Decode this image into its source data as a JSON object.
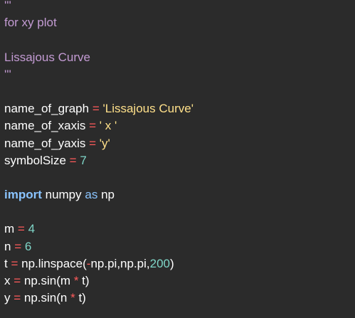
{
  "colors": {
    "background": "#2b2b2b",
    "docstring": "#c39bd3",
    "operator": "#ff5b5b",
    "string": "#ffe08a",
    "number": "#7fd6c8",
    "keyword": "#8ac4ff",
    "text": "#ffffff"
  },
  "lines": [
    [
      {
        "t": "doc",
        "v": "'''"
      }
    ],
    [
      {
        "t": "doc",
        "v": "for xy plot"
      }
    ],
    [],
    [
      {
        "t": "doc",
        "v": "Lissajous Curve"
      }
    ],
    [
      {
        "t": "doc",
        "v": "'''"
      }
    ],
    [],
    [
      {
        "t": "plain",
        "v": "name_of_graph "
      },
      {
        "t": "op",
        "v": "="
      },
      {
        "t": "plain",
        "v": " "
      },
      {
        "t": "str",
        "v": "'Lissajous Curve'"
      }
    ],
    [
      {
        "t": "plain",
        "v": "name_of_xaxis "
      },
      {
        "t": "op",
        "v": "="
      },
      {
        "t": "plain",
        "v": " "
      },
      {
        "t": "str",
        "v": "' x '"
      }
    ],
    [
      {
        "t": "plain",
        "v": "name_of_yaxis "
      },
      {
        "t": "op",
        "v": "="
      },
      {
        "t": "plain",
        "v": " "
      },
      {
        "t": "str",
        "v": "'y'"
      }
    ],
    [
      {
        "t": "plain",
        "v": "symbolSize "
      },
      {
        "t": "op",
        "v": "="
      },
      {
        "t": "plain",
        "v": " "
      },
      {
        "t": "num",
        "v": "7"
      }
    ],
    [],
    [
      {
        "t": "kw",
        "v": "import"
      },
      {
        "t": "plain",
        "v": " numpy "
      },
      {
        "t": "kw2",
        "v": "as"
      },
      {
        "t": "plain",
        "v": " np"
      }
    ],
    [],
    [
      {
        "t": "plain",
        "v": "m "
      },
      {
        "t": "op",
        "v": "="
      },
      {
        "t": "plain",
        "v": " "
      },
      {
        "t": "num",
        "v": "4"
      }
    ],
    [
      {
        "t": "plain",
        "v": "n "
      },
      {
        "t": "op",
        "v": "="
      },
      {
        "t": "plain",
        "v": " "
      },
      {
        "t": "num",
        "v": "6"
      }
    ],
    [
      {
        "t": "plain",
        "v": "t "
      },
      {
        "t": "op",
        "v": "="
      },
      {
        "t": "plain",
        "v": " np.linspace("
      },
      {
        "t": "op",
        "v": "-"
      },
      {
        "t": "plain",
        "v": "np.pi,np.pi,"
      },
      {
        "t": "num",
        "v": "200"
      },
      {
        "t": "plain",
        "v": ")"
      }
    ],
    [
      {
        "t": "plain",
        "v": "x "
      },
      {
        "t": "op",
        "v": "="
      },
      {
        "t": "plain",
        "v": " np.sin(m "
      },
      {
        "t": "op",
        "v": "*"
      },
      {
        "t": "plain",
        "v": " t)"
      }
    ],
    [
      {
        "t": "plain",
        "v": "y "
      },
      {
        "t": "op",
        "v": "="
      },
      {
        "t": "plain",
        "v": " np.sin(n "
      },
      {
        "t": "op",
        "v": "*"
      },
      {
        "t": "plain",
        "v": " t)"
      }
    ]
  ]
}
